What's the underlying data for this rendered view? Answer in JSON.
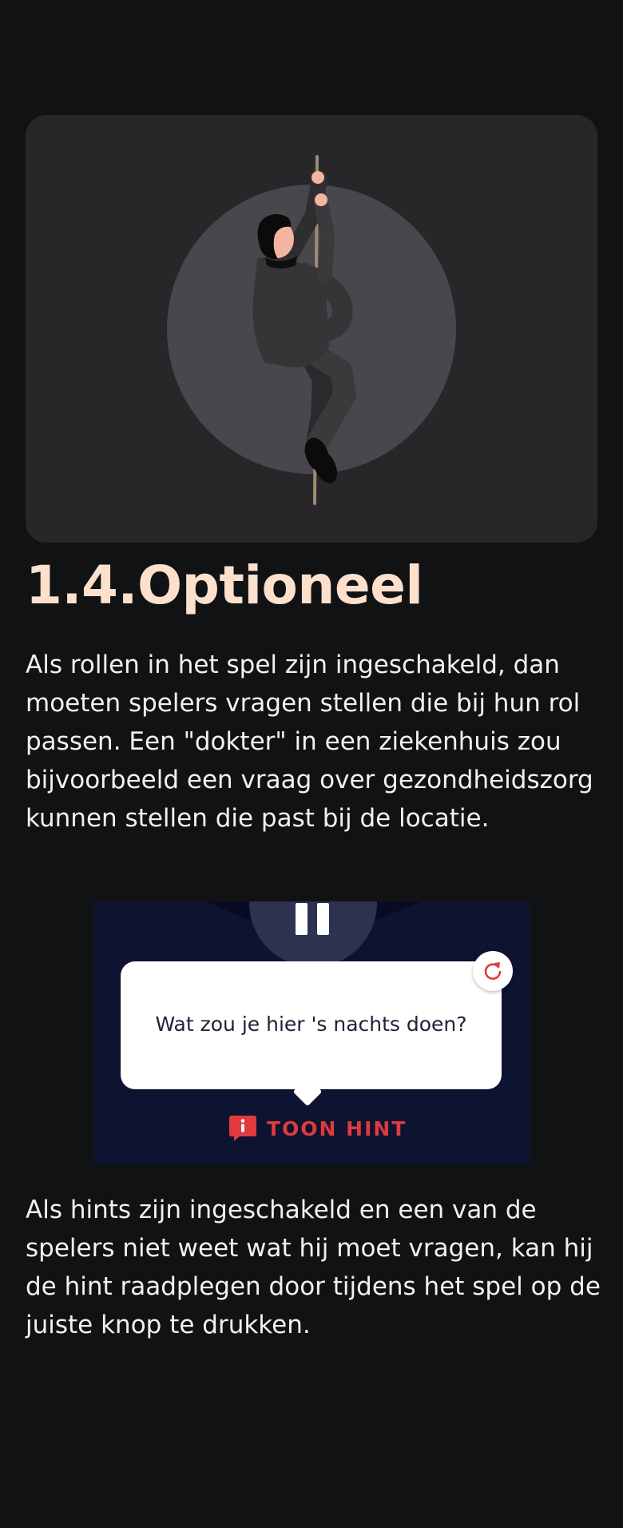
{
  "hero": {
    "illustration": "man-climbing-rope"
  },
  "section": {
    "title": "1.4.Optioneel"
  },
  "paragraphs": {
    "roles": "Als rollen in het spel zijn ingeschakeld, dan moeten spelers vragen stellen die bij hun rol passen. Een \"dokter\" in een ziekenhuis zou bijvoorbeeld een vraag over gezondheidszorg kunnen stellen die past bij de locatie.",
    "hints": "Als hints zijn ingeschakeld en een van de spelers niet weet wat hij moet vragen, kan hij de hint raadplegen door tijdens het spel op de juiste knop te drukken."
  },
  "game_preview": {
    "question": "Wat zou je hier 's nachts doen?",
    "hint_label": "TOON HINT",
    "icons": [
      "pause-icon",
      "refresh-icon",
      "hint-icon"
    ]
  },
  "colors": {
    "background": "#111214",
    "card": "#27272a",
    "title": "#fde0cc",
    "game_background": "#0d1330",
    "hint_red": "#e03a3e"
  }
}
